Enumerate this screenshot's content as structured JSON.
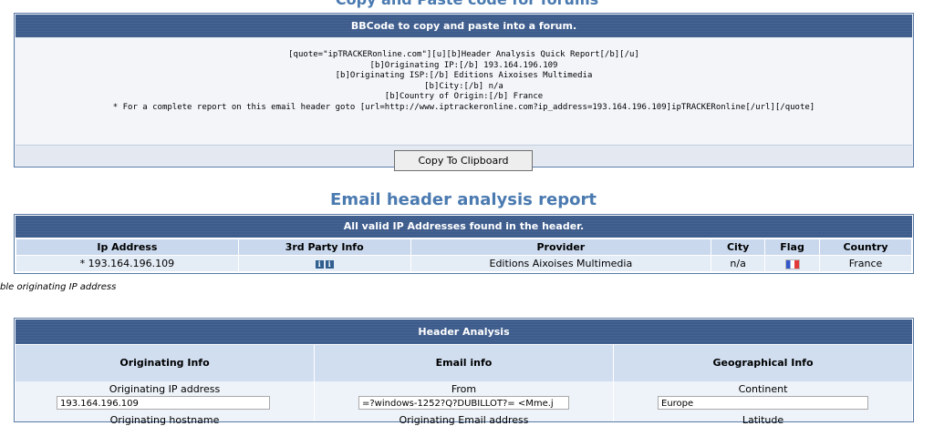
{
  "headings": {
    "copy_paste": "Copy and Paste code for forums",
    "report": "Email header analysis report"
  },
  "bbcode": {
    "banner": "BBCode to copy and paste into a forum.",
    "lines": [
      "[quote=\"ipTRACKERonline.com\"][u][b]Header Analysis Quick Report[/b][/u]",
      "[b]Originating IP:[/b] 193.164.196.109",
      "[b]Originating ISP:[/b] Editions Aixoises Multimedia",
      "[b]City:[/b] n/a",
      "[b]Country of Origin:[/b] France",
      "* For a complete report on this email header goto [url=http://www.iptrackeronline.com?ip_address=193.164.196.109]ipTRACKERonline[/url][/quote]"
    ],
    "button_label": "Copy To Clipboard"
  },
  "ip_table": {
    "banner": "All valid IP Addresses found in the header.",
    "columns": [
      "Ip Address",
      "3rd Party Info",
      "Provider",
      "City",
      "Flag",
      "Country"
    ],
    "rows": [
      {
        "ip": "* 193.164.196.109",
        "info_icons": [
          "i",
          "i"
        ],
        "provider": "Editions Aixoises Multimedia",
        "city": "n/a",
        "flag": "france-flag-icon",
        "country": "France"
      }
    ]
  },
  "footnote": "ble originating IP address",
  "header_analysis": {
    "banner": "Header Analysis",
    "columns": [
      "Originating Info",
      "Email info",
      "Geographical Info"
    ],
    "fields": [
      {
        "label": "Originating IP address",
        "value": "193.164.196.109",
        "next_label": "Originating hostname"
      },
      {
        "label": "From",
        "value": "=?windows-1252?Q?DUBILLOT?= <Mme.j",
        "next_label": "Originating Email address"
      },
      {
        "label": "Continent",
        "value": "Europe",
        "next_label": "Latitude"
      }
    ]
  },
  "colors": {
    "banner": "#3d5c8c",
    "heading": "#4a7ab0",
    "header_cell": "#c9d8ec",
    "row_cell": "#e4ecf6"
  }
}
